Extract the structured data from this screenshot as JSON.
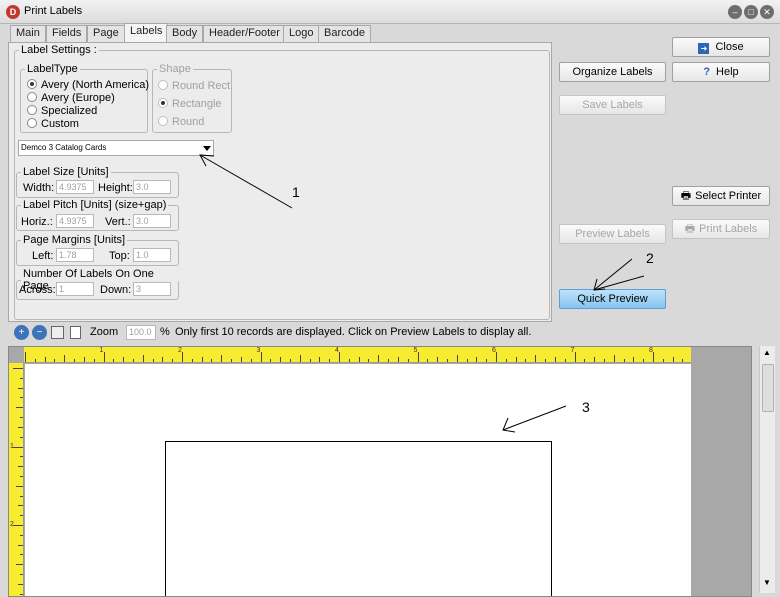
{
  "window": {
    "title": "Print Labels",
    "app_icon_glyph": "D"
  },
  "tabs": [
    {
      "label": "Main"
    },
    {
      "label": "Fields"
    },
    {
      "label": "Page"
    },
    {
      "label": "Labels"
    },
    {
      "label": "Body"
    },
    {
      "label": "Header/Footer"
    },
    {
      "label": "Logo"
    },
    {
      "label": "Barcode"
    }
  ],
  "label_settings": {
    "title": "Label Settings :",
    "label_type": {
      "title": "LabelType",
      "options": [
        "Avery (North America)",
        "Avery (Europe)",
        "Specialized",
        "Custom"
      ],
      "selected": "Avery (North America)"
    },
    "shape": {
      "title": "Shape",
      "options": [
        "Round Rect.",
        "Rectangle",
        "Round"
      ],
      "selected": "Rectangle"
    },
    "template": "Demco  3  Catalog Cards",
    "label_size": {
      "title": "Label Size [Units]",
      "width_label": "Width:",
      "width": "4.9375",
      "height_label": "Height:",
      "height": "3.0"
    },
    "label_pitch": {
      "title": "Label Pitch [Units] (size+gap)",
      "horiz_label": "Horiz.:",
      "horiz": "4.9375",
      "vert_label": "Vert.:",
      "vert": "3.0"
    },
    "page_margins": {
      "title": "Page Margins [Units]",
      "left_label": "Left:",
      "left": "1.78",
      "top_label": "Top:",
      "top": "1.0"
    },
    "labels_on_page": {
      "title": "Number Of Labels On One Page",
      "across_label": "Across:",
      "across": "1",
      "down_label": "Down:",
      "down": "3"
    }
  },
  "buttons": {
    "close": "Close",
    "help": "Help",
    "organize": "Organize Labels",
    "save": "Save Labels",
    "select_printer": "Select Printer",
    "print": "Print Labels",
    "preview": "Preview Labels",
    "quick_preview": "Quick Preview"
  },
  "toolbar": {
    "zoom_label": "Zoom",
    "zoom_value": "100.0",
    "percent": "%",
    "notice": "Only first 10 records are displayed. Click on Preview Labels to display all."
  },
  "ruler": {
    "top_numbers": [
      "1",
      "2",
      "3",
      "4",
      "5",
      "6",
      "7",
      "8"
    ],
    "left_numbers": [
      "1",
      "2"
    ]
  },
  "annotations": [
    "1",
    "2",
    "3"
  ],
  "colors": {
    "ruler": "#f7ec2f",
    "quick_preview": "#9ed0f4",
    "app_icon": "#c0392b"
  }
}
